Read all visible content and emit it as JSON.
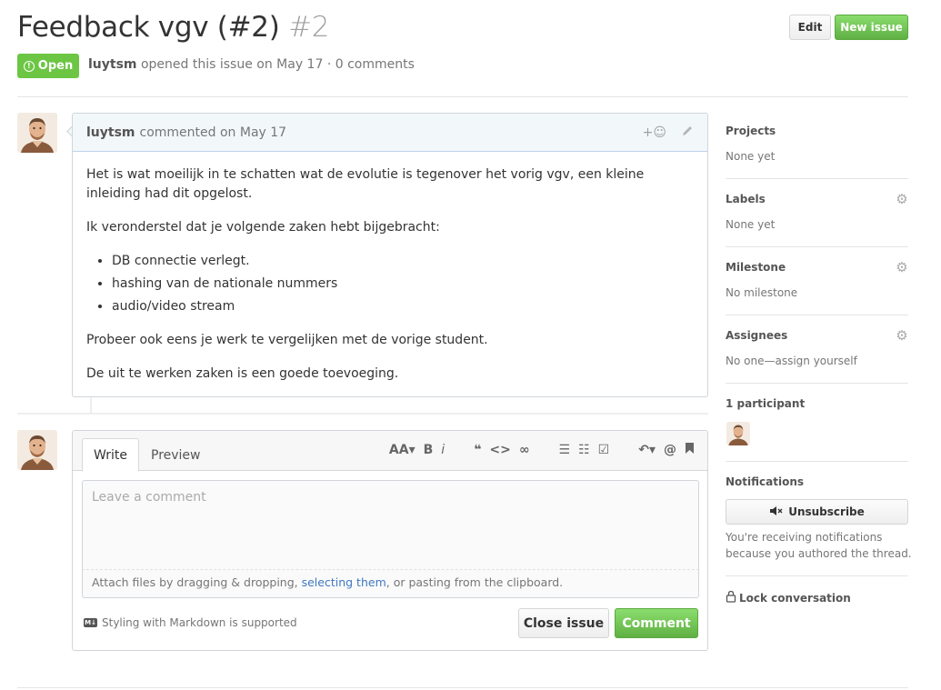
{
  "header": {
    "title": "Feedback vgv (#2)",
    "number": "#2",
    "edit_label": "Edit",
    "new_issue_label": "New issue",
    "state_label": "Open",
    "author": "luytsm",
    "meta_rest": "opened this issue on May 17 · 0 comments"
  },
  "comment": {
    "author": "luytsm",
    "action": "commented on May 17",
    "reaction_icon": "+☺",
    "paragraphs": [
      "Het is wat moeilijk in te schatten wat de evolutie is tegenover het vorig vgv, een kleine inleiding had dit opgelost.",
      "Ik veronderstel dat je volgende zaken hebt bijgebracht:"
    ],
    "list": [
      "DB connectie verlegt.",
      "hashing van de nationale nummers",
      "audio/video stream"
    ],
    "after_list": [
      "Probeer ook eens je werk te vergelijken met de vorige student.",
      "De uit te werken zaken is een goede toevoeging."
    ]
  },
  "form": {
    "tab_write": "Write",
    "tab_preview": "Preview",
    "placeholder": "Leave a comment",
    "attach_prefix": "Attach files by dragging & dropping, ",
    "attach_link": "selecting them",
    "attach_suffix": ", or pasting from the clipboard.",
    "markdown_note": "Styling with Markdown is supported",
    "markdown_badge": "M↓",
    "close_label": "Close issue",
    "comment_label": "Comment",
    "toolbar": {
      "heading": "AA▾",
      "bold": "B",
      "italic": "i",
      "quote": "❝",
      "code": "<>",
      "link": "∞",
      "ul": "☰",
      "ol": "☷",
      "task": "☑",
      "reply": "↶▾",
      "mention": "@",
      "bookmark": "🔖"
    }
  },
  "sidebar": {
    "projects_title": "Projects",
    "projects_value": "None yet",
    "labels_title": "Labels",
    "labels_value": "None yet",
    "milestone_title": "Milestone",
    "milestone_value": "No milestone",
    "assignees_title": "Assignees",
    "assignees_value": "No one—assign yourself",
    "participants_title": "1 participant",
    "notifications_title": "Notifications",
    "unsubscribe_label": "Unsubscribe",
    "notif_text": "You're receiving notifications because you authored the thread.",
    "lock_label": "Lock conversation"
  },
  "colors": {
    "open_green": "#6cc644",
    "link_blue": "#4078c0",
    "comment_header": "#f2f8fa"
  }
}
